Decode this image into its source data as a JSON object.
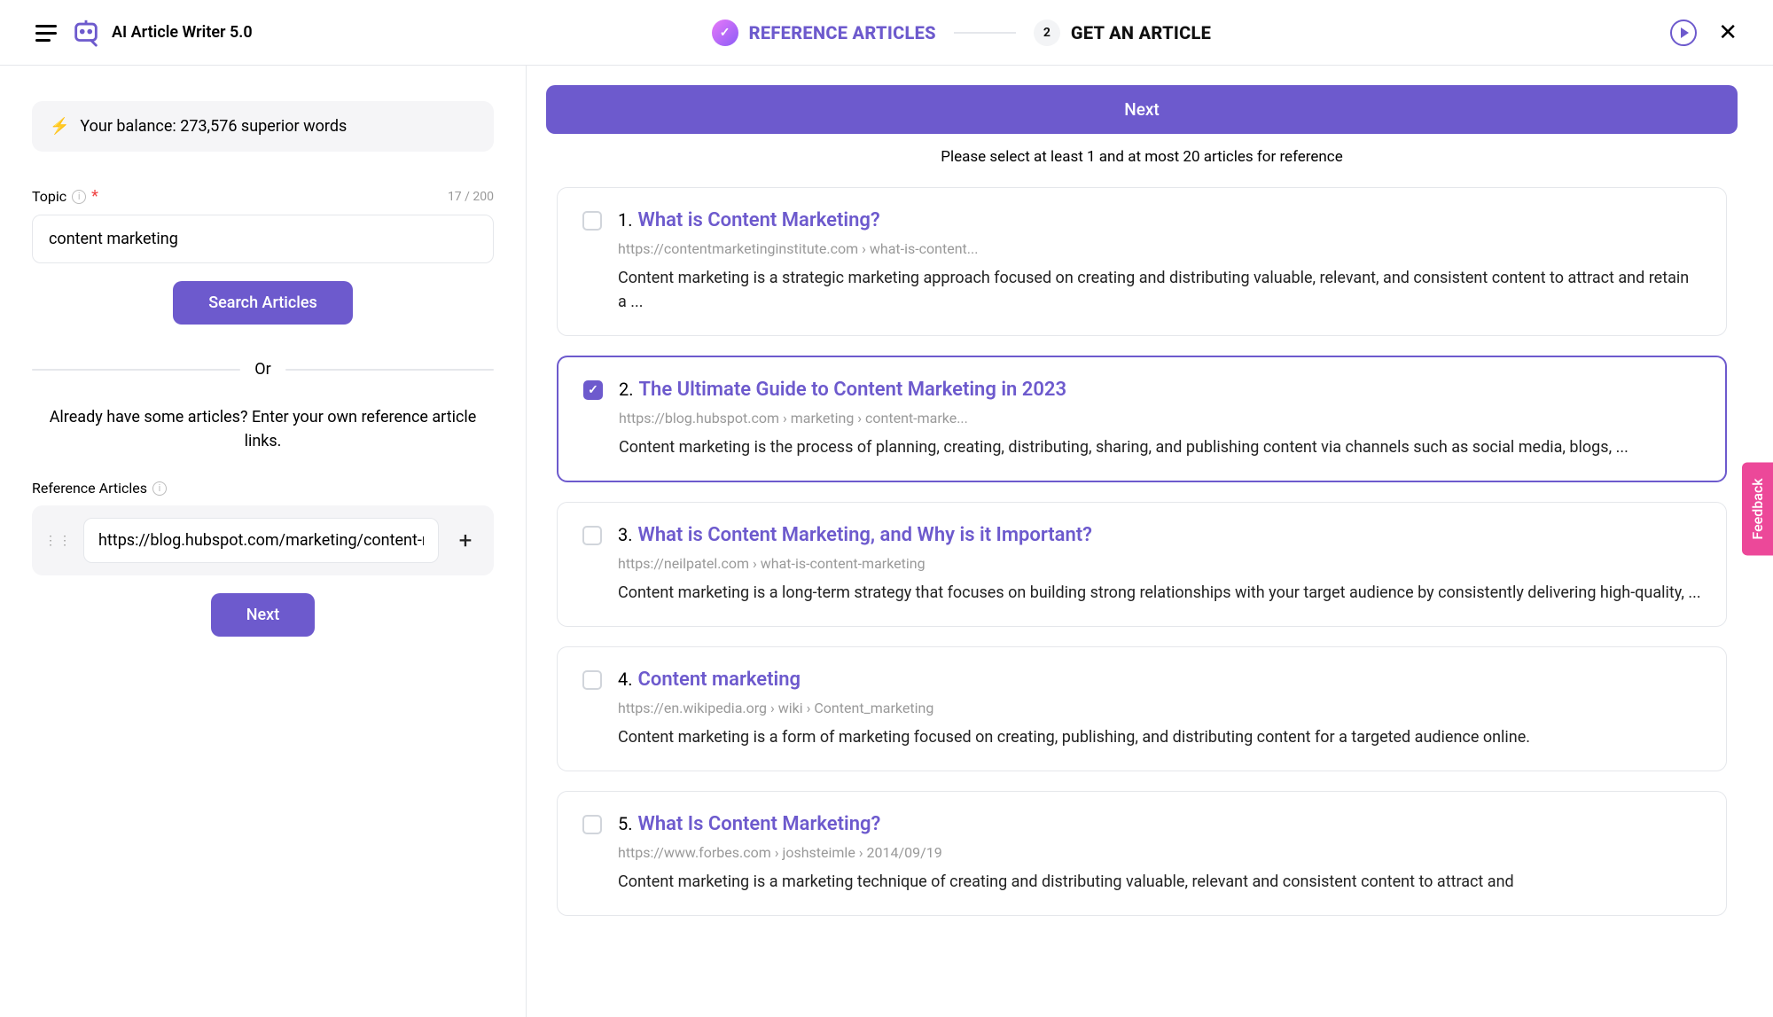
{
  "header": {
    "app_title": "AI Article Writer 5.0",
    "steps": [
      {
        "badge": "✓",
        "label": "REFERENCE ARTICLES",
        "state": "done"
      },
      {
        "badge": "2",
        "label": "GET AN ARTICLE",
        "state": "pending"
      }
    ]
  },
  "sidebar": {
    "balance_text": "Your balance: 273,576 superior words",
    "topic": {
      "label": "Topic",
      "counter": "17 / 200",
      "value": "content marketing"
    },
    "search_btn": "Search Articles",
    "or": "Or",
    "help_text": "Already have some articles? Enter your own reference article links.",
    "ref_label": "Reference Articles",
    "ref_input_value": "https://blog.hubspot.com/marketing/content-marketing",
    "next_btn": "Next"
  },
  "content": {
    "next_btn": "Next",
    "hint": "Please select at least 1 and at most 20 articles for reference",
    "results": [
      {
        "num": "1.",
        "title": "What is Content Marketing?",
        "url": "https://contentmarketinginstitute.com › what-is-content...",
        "desc": "Content marketing is a strategic marketing approach focused on creating and distributing valuable, relevant, and consistent content to attract and retain a ...",
        "selected": false
      },
      {
        "num": "2.",
        "title": "The Ultimate Guide to Content Marketing in 2023",
        "url": "https://blog.hubspot.com › marketing › content-marke...",
        "desc": "Content marketing is the process of planning, creating, distributing, sharing, and publishing content via channels such as social media, blogs, ...",
        "selected": true
      },
      {
        "num": "3.",
        "title": "What is Content Marketing, and Why is it Important?",
        "url": "https://neilpatel.com › what-is-content-marketing",
        "desc": "Content marketing is a long-term strategy that focuses on building strong relationships with your target audience by consistently delivering high-quality, ...",
        "selected": false
      },
      {
        "num": "4.",
        "title": "Content marketing",
        "url": "https://en.wikipedia.org › wiki › Content_marketing",
        "desc": "Content marketing is a form of marketing focused on creating, publishing, and distributing content for a targeted audience online.",
        "selected": false
      },
      {
        "num": "5.",
        "title": "What Is Content Marketing?",
        "url": "https://www.forbes.com › joshsteimle › 2014/09/19",
        "desc": "Content marketing is a marketing technique of creating and distributing valuable, relevant and consistent content to attract and",
        "selected": false
      }
    ]
  },
  "feedback": "Feedback"
}
